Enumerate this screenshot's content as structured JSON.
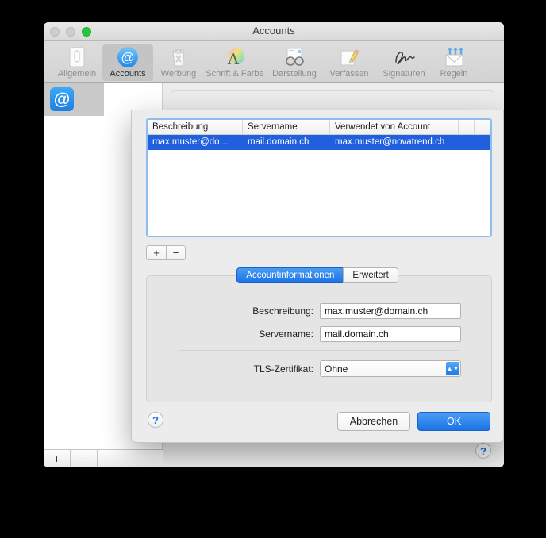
{
  "window": {
    "title": "Accounts",
    "traffic_lights": [
      "close",
      "minimize",
      "zoom"
    ]
  },
  "toolbar": {
    "items": [
      {
        "label": "Allgemein",
        "icon": "general-icon",
        "selected": false
      },
      {
        "label": "Accounts",
        "icon": "at-sign-icon",
        "selected": true
      },
      {
        "label": "Werbung",
        "icon": "junk-bin-icon",
        "selected": false
      },
      {
        "label": "Schrift & Farbe",
        "icon": "font-color-icon",
        "selected": false
      },
      {
        "label": "Darstellung",
        "icon": "glasses-icon",
        "selected": false
      },
      {
        "label": "Verfassen",
        "icon": "pencil-pad-icon",
        "selected": false
      },
      {
        "label": "Signaturen",
        "icon": "signature-icon",
        "selected": false
      },
      {
        "label": "Regeln",
        "icon": "rules-mail-icon",
        "selected": false
      }
    ]
  },
  "background_window": {
    "sidebar_account_icon": "at-sign-icon",
    "segmented_buttons": [
      "+",
      "−",
      ""
    ],
    "help_label": "?"
  },
  "sheet": {
    "table": {
      "columns": [
        "Beschreibung",
        "Servername",
        "Verwendet von Account",
        "",
        ""
      ],
      "rows": [
        {
          "beschreibung": "max.muster@do…",
          "servername": "mail.domain.ch",
          "verwendet_von_account": "max.muster@novatrend.ch",
          "selected": true
        }
      ]
    },
    "table_actions": {
      "add": "+",
      "remove": "−"
    },
    "tabs": [
      {
        "label": "Accountinformationen",
        "active": true
      },
      {
        "label": "Erweitert",
        "active": false
      }
    ],
    "fields": [
      {
        "label": "Beschreibung:",
        "value": "max.muster@domain.ch",
        "type": "text"
      },
      {
        "label": "Servername:",
        "value": "mail.domain.ch",
        "type": "text"
      },
      {
        "label": "TLS-Zertifikat:",
        "value": "Ohne",
        "type": "popup"
      }
    ],
    "help_label": "?",
    "buttons": {
      "cancel": "Abbrechen",
      "ok": "OK"
    }
  },
  "colors": {
    "accent_blue": "#1a73e8",
    "selection_blue": "#2060df",
    "focus_ring": "#8fbdf0",
    "window_bg": "#ececec"
  }
}
